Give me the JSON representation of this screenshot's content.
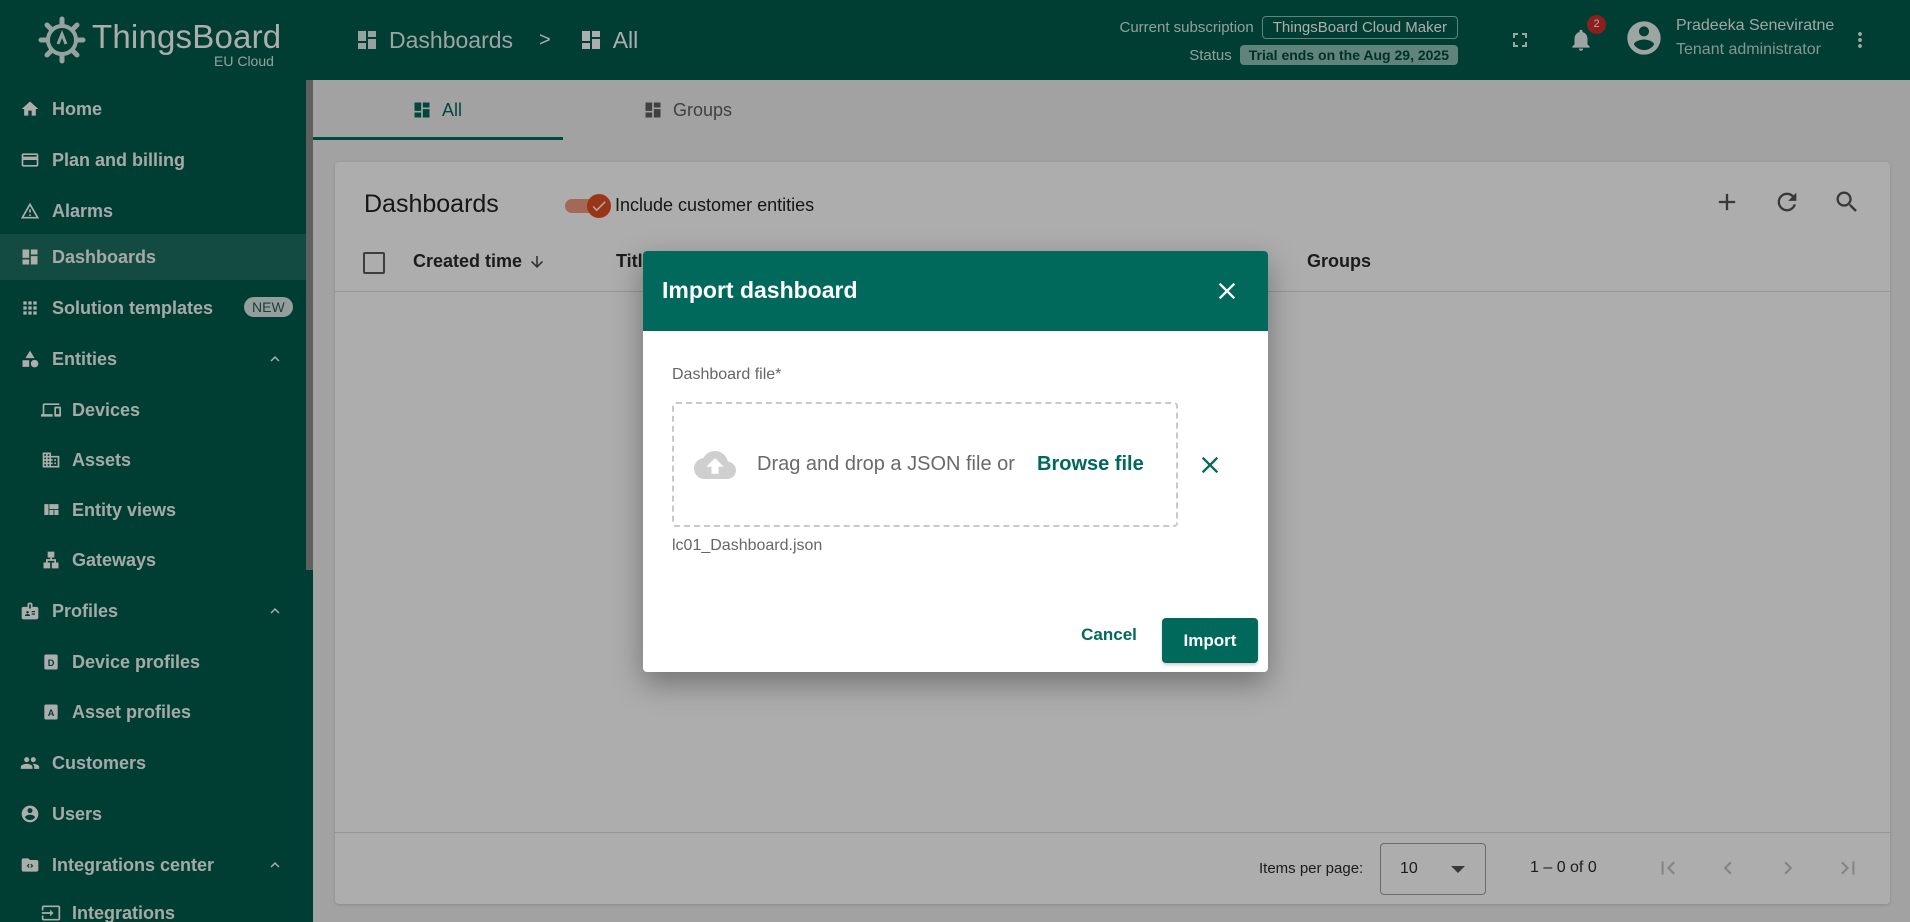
{
  "brand": {
    "name": "ThingsBoard",
    "sub": "EU Cloud"
  },
  "breadcrumb": {
    "first": "Dashboards",
    "separator": ">",
    "second": "All"
  },
  "subscription": {
    "label": "Current subscription",
    "plan": "ThingsBoard Cloud Maker",
    "status_label": "Status",
    "status": "Trial ends on the Aug 29, 2025"
  },
  "notifications": {
    "count": "2"
  },
  "user": {
    "name": "Pradeeka Seneviratne",
    "role": "Tenant administrator"
  },
  "sidebar": {
    "items": [
      {
        "label": "Home",
        "icon": "home-icon"
      },
      {
        "label": "Plan and billing",
        "icon": "credit-card-icon"
      },
      {
        "label": "Alarms",
        "icon": "warning-icon"
      },
      {
        "label": "Dashboards",
        "icon": "dashboard-icon"
      },
      {
        "label": "Solution templates",
        "icon": "apps-icon",
        "badge": "NEW"
      },
      {
        "label": "Entities",
        "icon": "shapes-icon"
      },
      {
        "label": "Devices",
        "icon": "devices-icon"
      },
      {
        "label": "Assets",
        "icon": "domain-icon"
      },
      {
        "label": "Entity views",
        "icon": "view-quilt-icon"
      },
      {
        "label": "Gateways",
        "icon": "lan-icon"
      },
      {
        "label": "Profiles",
        "icon": "badge-icon"
      },
      {
        "label": "Device profiles",
        "icon": "device-profile-icon"
      },
      {
        "label": "Asset profiles",
        "icon": "asset-profile-icon"
      },
      {
        "label": "Customers",
        "icon": "people-icon"
      },
      {
        "label": "Users",
        "icon": "account-icon"
      },
      {
        "label": "Integrations center",
        "icon": "integration-icon"
      },
      {
        "label": "Integrations",
        "icon": "input-icon"
      }
    ]
  },
  "tabs": [
    {
      "label": "All"
    },
    {
      "label": "Groups"
    }
  ],
  "card": {
    "title": "Dashboards",
    "toggle_label": "Include customer entities",
    "columns": {
      "created": "Created time",
      "title": "Title",
      "groups": "Groups"
    }
  },
  "pagination": {
    "items_label": "Items per page:",
    "page_size": "10",
    "range": "1 – 0 of 0"
  },
  "dialog": {
    "title": "Import dashboard",
    "field_label": "Dashboard file*",
    "drop_text": "Drag and drop a JSON file or",
    "browse": "Browse file",
    "file_name": "lc01_Dashboard.json",
    "cancel": "Cancel",
    "import": "Import"
  },
  "colors": {
    "primary": "#005a4c",
    "accent": "#00695c",
    "toggle": "#e45024",
    "badge": "#d32f2f"
  }
}
